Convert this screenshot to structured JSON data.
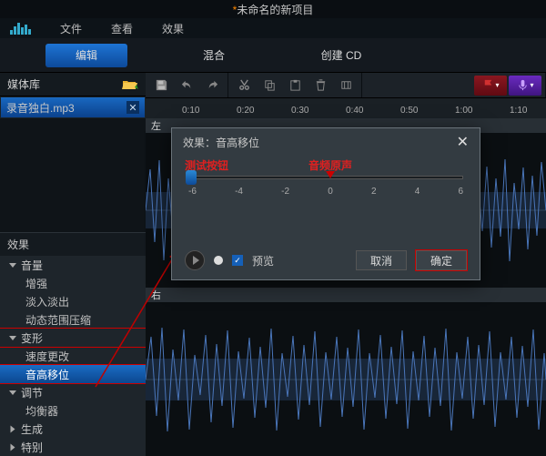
{
  "titlebar": {
    "prefix_ast": "*",
    "title": "未命名的新项目"
  },
  "menu": {
    "file": "文件",
    "view": "查看",
    "effect": "效果"
  },
  "tabs": {
    "edit": "编辑",
    "mix": "混合",
    "cd": "创建 CD"
  },
  "panels": {
    "media": "媒体库",
    "effects": "效果"
  },
  "media_items": [
    {
      "name": "录音独白.mp3"
    }
  ],
  "effect_tree": {
    "volume": {
      "label": "音量",
      "items": [
        "增强",
        "淡入淡出",
        "动态范围压缩"
      ]
    },
    "transform": {
      "label": "变形",
      "items": [
        "速度更改",
        "音高移位"
      ]
    },
    "adjust": {
      "label": "调节",
      "items": [
        "均衡器"
      ]
    },
    "generate": {
      "label": "生成"
    },
    "special": {
      "label": "特别"
    }
  },
  "ruler": [
    "0:10",
    "0:20",
    "0:30",
    "0:40",
    "0:50",
    "1:00",
    "1:10"
  ],
  "channels": {
    "left": "左",
    "right": "右"
  },
  "dialog": {
    "title": "效果：音高移位",
    "ann_left": "测试按钮",
    "ann_center": "音频原声",
    "ticks": [
      "-6",
      "-4",
      "-2",
      "0",
      "2",
      "4",
      "6"
    ],
    "preview": "预览",
    "cancel": "取消",
    "ok": "确定"
  }
}
